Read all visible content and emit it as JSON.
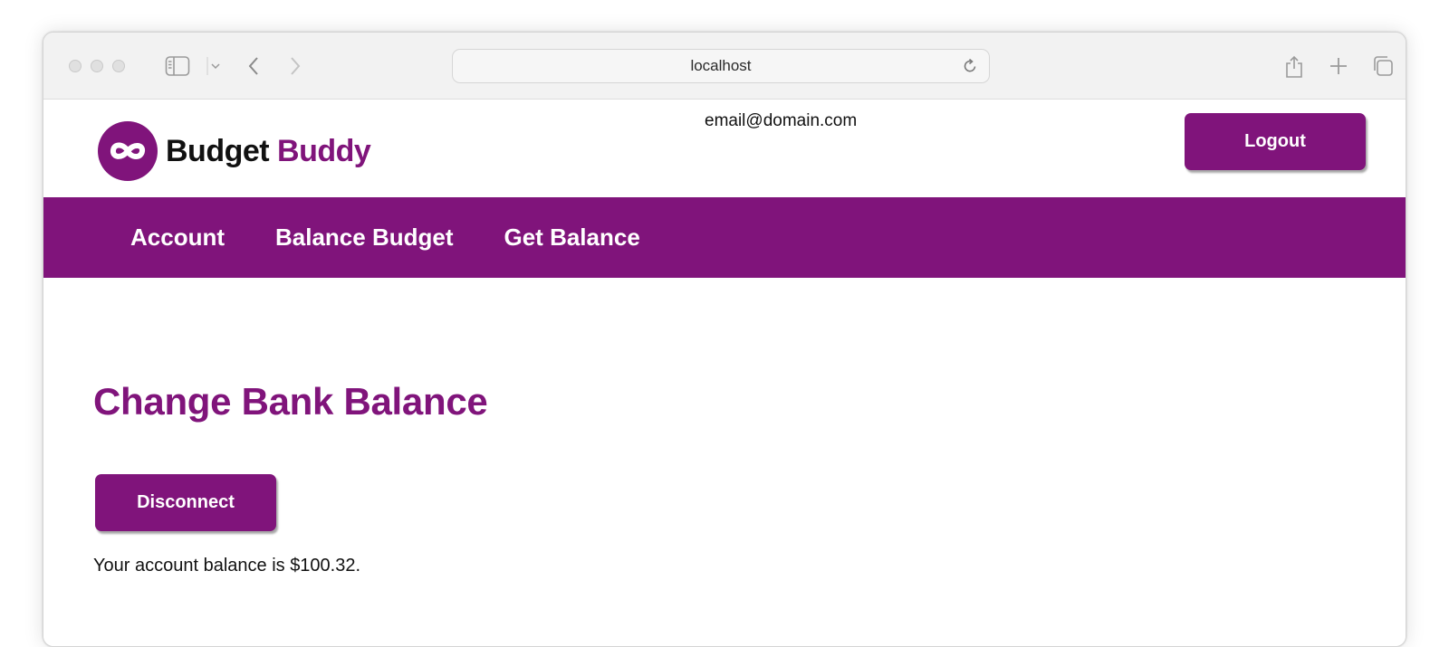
{
  "browser": {
    "address": "localhost",
    "icons": {
      "sidebar": "sidebar-icon",
      "sidebar_chevron": "chevron-down-icon",
      "back": "chevron-left-icon",
      "forward": "chevron-right-icon",
      "reload": "reload-icon",
      "share": "share-icon",
      "new_tab": "plus-icon",
      "tabs": "tabs-overview-icon"
    }
  },
  "header": {
    "logo_main": "Budget",
    "logo_accent": "Buddy",
    "user_email": "email@domain.com",
    "logout_label": "Logout"
  },
  "nav": {
    "items": [
      {
        "label": "Account"
      },
      {
        "label": "Balance Budget"
      },
      {
        "label": "Get Balance"
      }
    ]
  },
  "main": {
    "title": "Change Bank Balance",
    "disconnect_label": "Disconnect",
    "balance_message": "Your account balance is $100.32."
  },
  "colors": {
    "brand": "#80147b",
    "text": "#111111",
    "toolbar_bg": "#f2f2f2"
  }
}
